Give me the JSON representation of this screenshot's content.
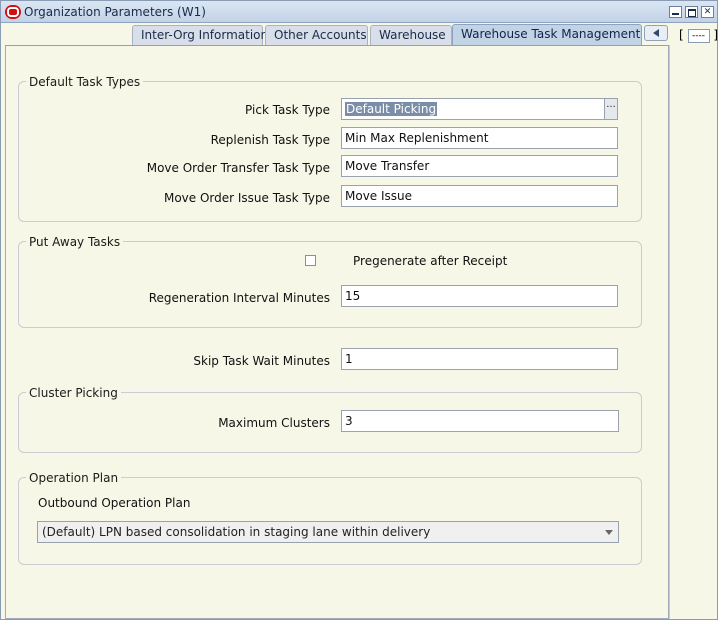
{
  "window": {
    "title": "Organization Parameters (W1)"
  },
  "tabs": [
    {
      "label": "Inter-Org Information"
    },
    {
      "label": "Other Accounts"
    },
    {
      "label": "Warehouse"
    },
    {
      "label": "Warehouse Task Management",
      "active": true
    }
  ],
  "tab_more": {
    "open": "[",
    "value": "----",
    "close": "]"
  },
  "default_task_types": {
    "title": "Default Task Types",
    "pick_label": "Pick Task Type",
    "pick_value": "Default Picking",
    "lov_glyph": "···",
    "replenish_label": "Replenish Task Type",
    "replenish_value": "Min Max Replenishment",
    "mo_transfer_label": "Move Order Transfer Task Type",
    "mo_transfer_value": "Move Transfer",
    "mo_issue_label": "Move Order Issue Task Type",
    "mo_issue_value": "Move Issue"
  },
  "put_away": {
    "title": "Put Away Tasks",
    "pregenerate_label": "Pregenerate after Receipt",
    "pregenerate_checked": false,
    "regen_label": "Regeneration Interval Minutes",
    "regen_value": "15"
  },
  "skip_task": {
    "label": "Skip Task Wait Minutes",
    "value": "1"
  },
  "cluster_picking": {
    "title": "Cluster Picking",
    "max_label": "Maximum Clusters",
    "max_value": "3"
  },
  "operation_plan": {
    "title": "Operation Plan",
    "outbound_label": "Outbound Operation Plan",
    "outbound_value": "(Default) LPN based consolidation in staging lane within delivery"
  },
  "colors": {
    "background": "#f7f7e7",
    "active_tab": "#c3d3e6",
    "selection": "#7b8ea8"
  }
}
